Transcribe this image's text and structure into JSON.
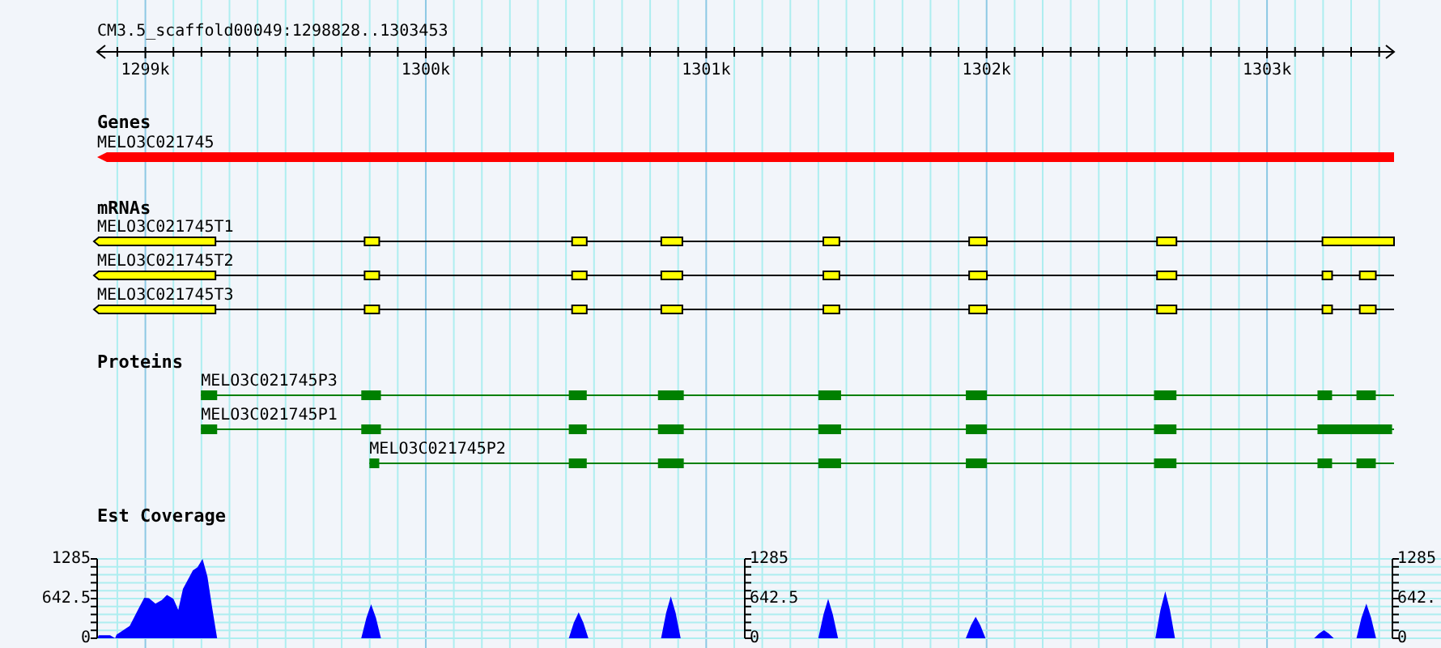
{
  "ruler": {
    "title": "CM3.5_scaffold00049:1298828..1303453",
    "ticks": [
      "1299k",
      "1300k",
      "1301k",
      "1302k",
      "1303k"
    ]
  },
  "tracks": [
    {
      "kind": "genes",
      "title": "Genes",
      "features": [
        {
          "label": "MELO3C021745"
        }
      ]
    },
    {
      "kind": "mrna",
      "title": "mRNAs",
      "features": [
        {
          "label": "MELO3C021745T1"
        },
        {
          "label": "MELO3C021745T2"
        },
        {
          "label": "MELO3C021745T3"
        }
      ]
    },
    {
      "kind": "proteins",
      "title": "Proteins",
      "features": [
        {
          "label": "MELO3C021745P3"
        },
        {
          "label": "MELO3C021745P1"
        },
        {
          "label": "MELO3C021745P2"
        }
      ]
    },
    {
      "kind": "coverage",
      "title": "Est Coverage",
      "axes": [
        {
          "labels": [
            "1285",
            "642.5",
            "0"
          ]
        },
        {
          "labels": [
            "1285",
            "642.5",
            "0"
          ]
        },
        {
          "labels": [
            "1285",
            "642.",
            "0"
          ]
        }
      ]
    }
  ]
}
